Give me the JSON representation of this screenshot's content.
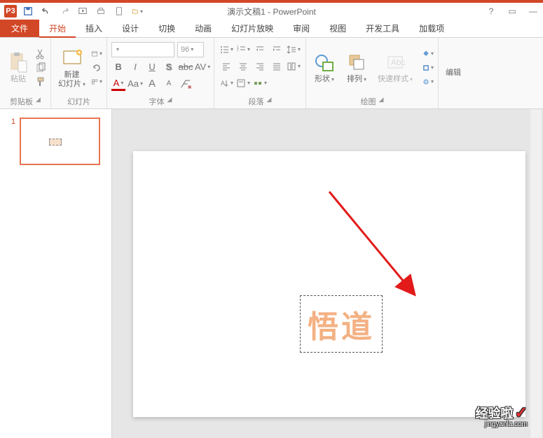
{
  "app": {
    "title": "演示文稿1 - PowerPoint",
    "icon": "P3"
  },
  "win": {
    "help": "?",
    "ribbon_opts": "▭",
    "min": "—"
  },
  "tabs": {
    "file": "文件",
    "home": "开始",
    "insert": "插入",
    "design": "设计",
    "transition": "切换",
    "animation": "动画",
    "slideshow": "幻灯片放映",
    "review": "审阅",
    "view": "视图",
    "developer": "开发工具",
    "addins": "加载项"
  },
  "ribbon": {
    "clipboard": {
      "label": "剪贴板",
      "paste": "粘贴"
    },
    "slides": {
      "label": "幻灯片",
      "new_slide": "新建\n幻灯片"
    },
    "font": {
      "label": "字体",
      "size": "96",
      "glyphs": {
        "b": "B",
        "i": "I",
        "u": "U",
        "s": "S",
        "abc": "abc",
        "av": "AV",
        "a_big": "A",
        "aa": "Aa",
        "aup": "A",
        "adown": "A"
      }
    },
    "para": {
      "label": "段落"
    },
    "draw": {
      "label": "绘图",
      "shapes": "形状",
      "arrange": "排列",
      "quick": "快速样式"
    },
    "edit": {
      "label": "编辑"
    }
  },
  "slide": {
    "num": "1",
    "wordart": "悟道"
  },
  "watermark": {
    "text": "经验啦",
    "url": "jingyanla.com"
  }
}
